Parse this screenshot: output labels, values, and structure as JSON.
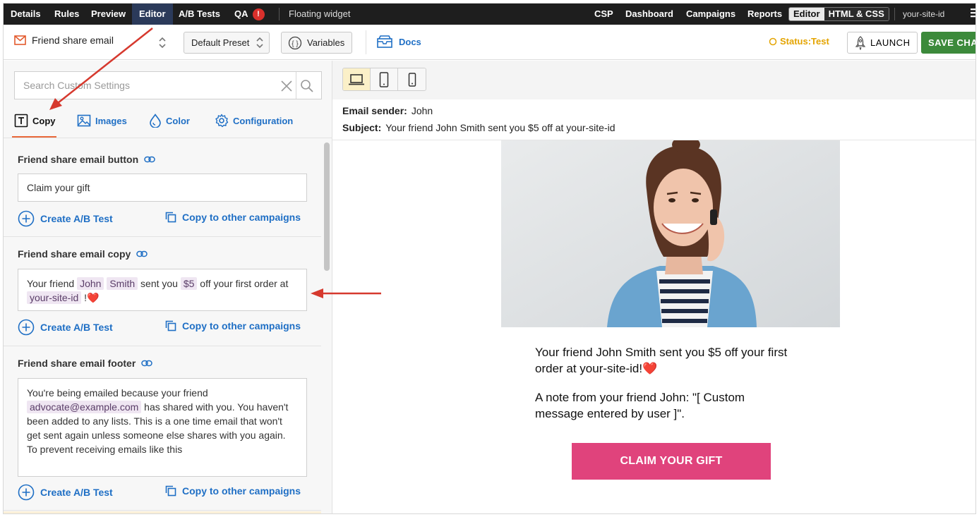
{
  "topnav": {
    "left_items": [
      "Details",
      "Rules",
      "Preview",
      "Editor",
      "A/B Tests",
      "QA"
    ],
    "qa_badge": "!",
    "widget_label": "Floating widget",
    "right_items": [
      "CSP",
      "Dashboard",
      "Campaigns",
      "Reports"
    ],
    "mode_toggle": [
      "Editor",
      "HTML & CSS"
    ],
    "site_id": "your-site-id"
  },
  "toolbar": {
    "email_name": "Friend share email",
    "preset": "Default Preset",
    "variables": "Variables",
    "docs": "Docs",
    "status": "Status:Test",
    "launch": "LAUNCH",
    "save": "SAVE CHA"
  },
  "sidebar": {
    "search_placeholder": "Search Custom Settings",
    "tabs": [
      "Copy",
      "Images",
      "Color",
      "Configuration"
    ],
    "sections": [
      {
        "title": "Friend share email button",
        "value": "Claim your gift",
        "ab_test": "Create A/B Test",
        "copy_to": "Copy to other campaigns"
      },
      {
        "title": "Friend share email copy",
        "parts": [
          "Your friend ",
          "John",
          " ",
          "Smith",
          " sent you ",
          "$5",
          " off your first order at ",
          "your-site-id",
          " !❤️"
        ],
        "ab_test": "Create A/B Test",
        "copy_to": "Copy to other campaigns"
      },
      {
        "title": "Friend share email footer",
        "parts": [
          "You're being emailed because your friend ",
          "advocate@example.com",
          " has shared with you. You haven't been added to any lists. This is a one time email that won't get sent again unless someone else shares with you again. To prevent receiving emails like this"
        ],
        "ab_test": "Create A/B Test",
        "copy_to": "Copy to other campaigns"
      }
    ]
  },
  "preview": {
    "sender_label": "Email sender:",
    "sender_value": "John",
    "subject_label": "Subject:",
    "subject_value": "Your friend John Smith sent you $5 off at your-site-id",
    "body_line1": "Your friend John Smith sent you $5 off your first order at your-site-id!❤️",
    "body_line2": "A note from your friend John: \"[ Custom message entered by user ]\".",
    "cta": "CLAIM YOUR GIFT"
  },
  "colors": {
    "accent_blue": "#1f6fc5",
    "status_amber": "#e4a400",
    "save_green": "#3c8a3b",
    "cta_pink": "#e0437c",
    "annotation_red": "#d6392e"
  }
}
